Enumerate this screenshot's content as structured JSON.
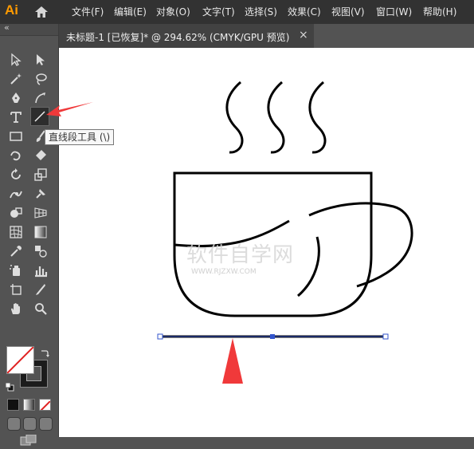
{
  "app": {
    "logo": "Ai"
  },
  "menu": [
    "文件(F)",
    "编辑(E)",
    "对象(O)",
    "文字(T)",
    "选择(S)",
    "效果(C)",
    "视图(V)",
    "窗口(W)",
    "帮助(H)"
  ],
  "tab": {
    "title": "未标题-1 [已恢复]* @ 294.62% (CMYK/GPU 预览)",
    "close": "×"
  },
  "tooltip": "直线段工具 (\\)",
  "toolbar": {
    "collapse": "«"
  },
  "watermark": {
    "main": "软件自学网",
    "sub": "WWW.RJZXW.COM"
  },
  "colors": {
    "annotation_arrow": "#f0393a",
    "selection": "#3355cc",
    "accent": "#ff9a00"
  },
  "icons": [
    "home-icon",
    "select-icon",
    "direct-select-icon",
    "magic-wand-icon",
    "lasso-icon",
    "pen-icon",
    "curvature-icon",
    "type-icon",
    "line-segment-icon",
    "rectangle-icon",
    "paintbrush-icon",
    "shaper-icon",
    "eraser-icon",
    "rotate-icon",
    "scale-icon",
    "warp-icon",
    "free-transform-icon",
    "shape-builder-icon",
    "perspective-icon",
    "mesh-icon",
    "gradient-icon",
    "eyedropper-icon",
    "blend-icon",
    "symbol-sprayer-icon",
    "graph-icon",
    "artboard-icon",
    "slice-icon",
    "hand-icon",
    "zoom-icon"
  ]
}
